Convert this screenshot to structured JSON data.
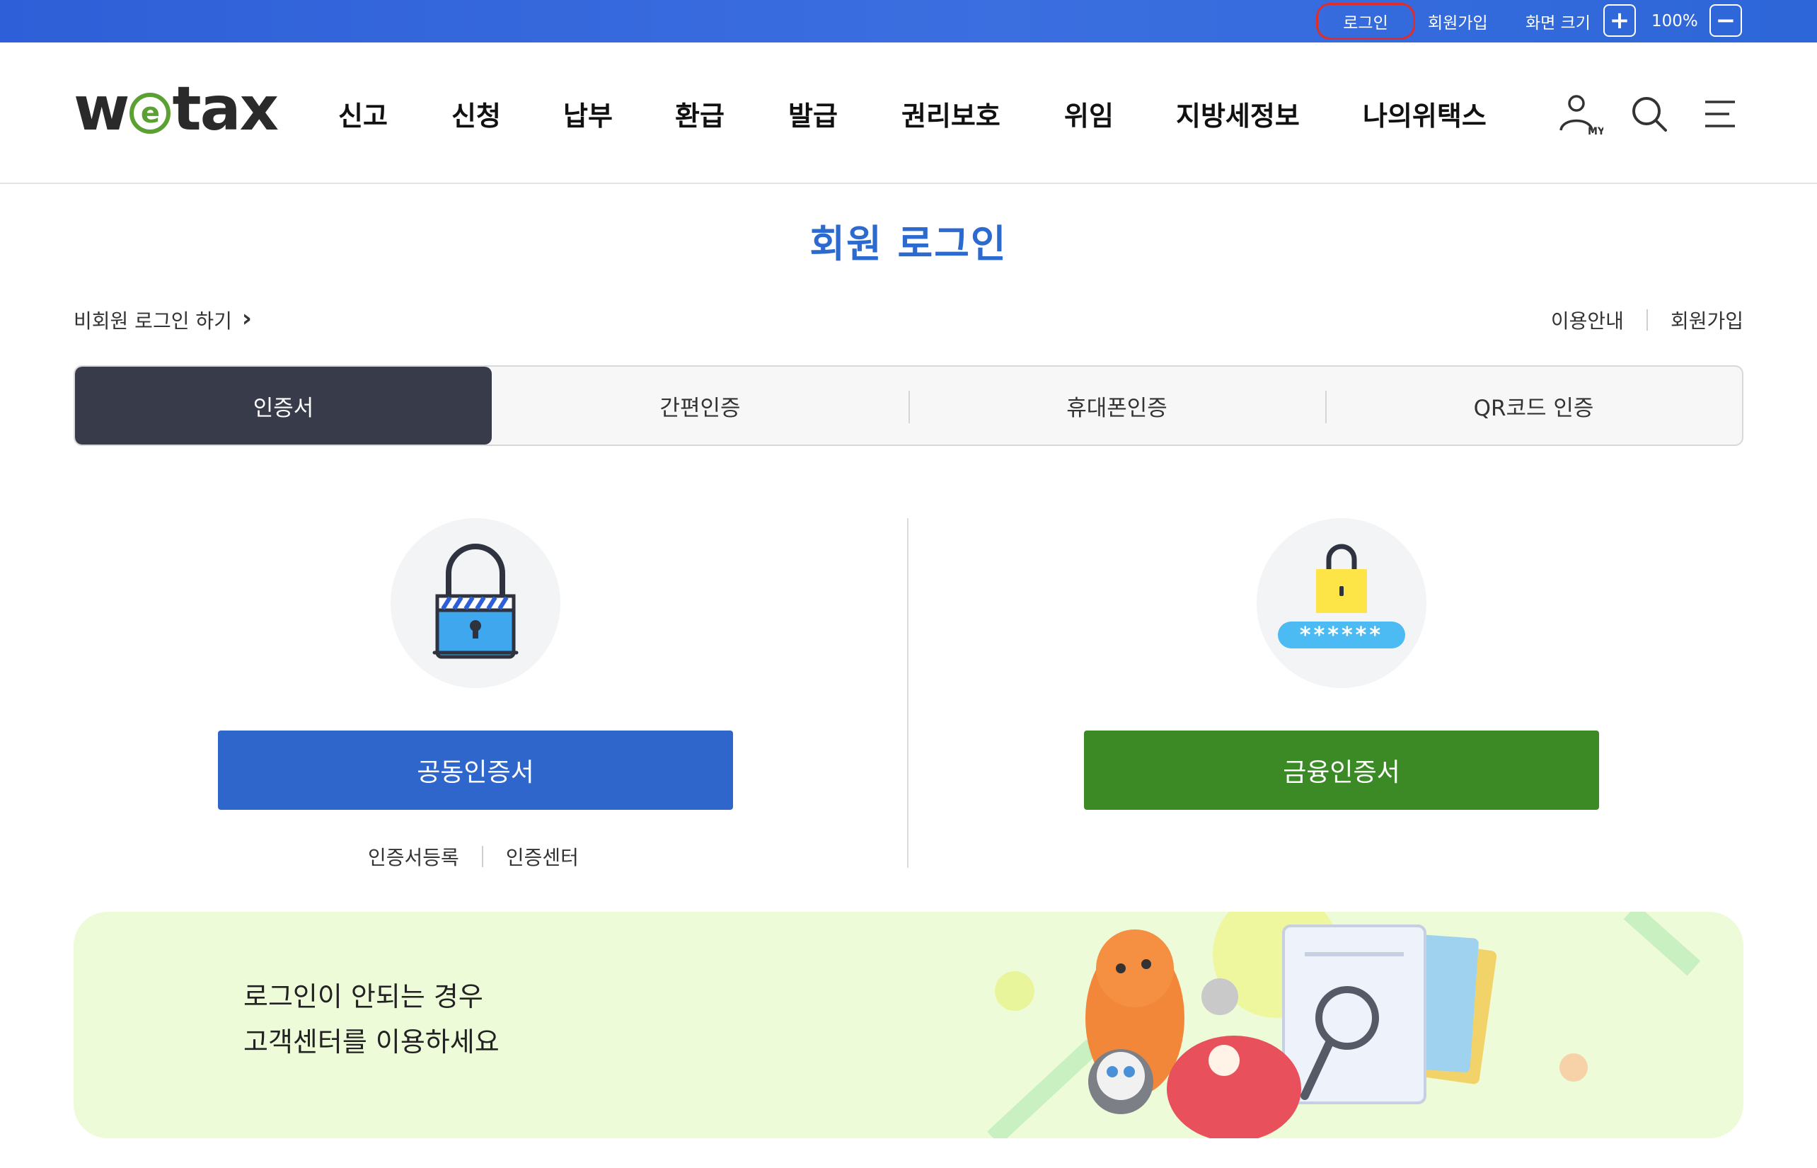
{
  "topbar": {
    "login": "로그인",
    "join": "회원가입",
    "screen_size": "화면 크기",
    "zoom_in": "+",
    "zoom_level": "100%",
    "zoom_out": "−"
  },
  "header": {
    "logo_left": "w",
    "logo_e": "e",
    "logo_right": "tax",
    "nav": [
      "신고",
      "신청",
      "납부",
      "환급",
      "발급",
      "권리보호",
      "위임",
      "지방세정보",
      "나의위택스"
    ],
    "icons": [
      "my-user-icon",
      "search-icon",
      "menu-icon"
    ],
    "my_badge": "MY"
  },
  "main": {
    "title": "회원 로그인",
    "guest_login": "비회원 로그인 하기",
    "guide": "이용안내",
    "join": "회원가입",
    "tabs": [
      "인증서",
      "간편인증",
      "휴대폰인증",
      "QR코드 인증"
    ],
    "active_tab": "인증서",
    "joint_cert_button": "공동인증서",
    "financial_cert_button": "금융인증서",
    "cert_register": "인증서등록",
    "cert_center": "인증센터",
    "password_mask": "******"
  },
  "banner": {
    "line1": "로그인이 안되는 경우",
    "line2": "고객센터를 이용하세요"
  },
  "colors": {
    "topbar": "#2f5fd8",
    "title": "#2c6ad0",
    "active_tab": "#383b4a",
    "joint_button": "#2f66cc",
    "financial_button": "#3b8a26",
    "banner_bg": "#eefbd9",
    "logo_green": "#5ba033"
  }
}
